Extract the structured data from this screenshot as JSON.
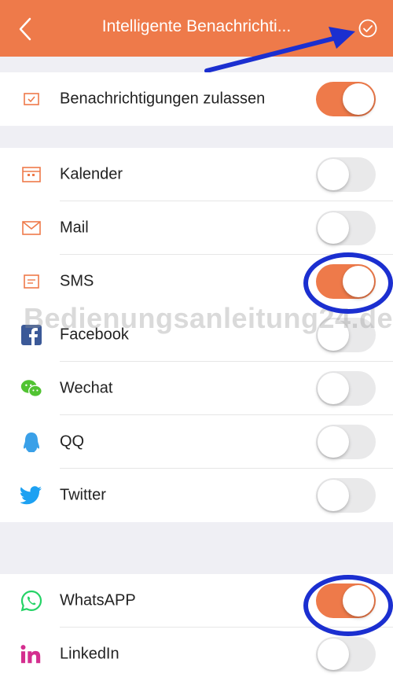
{
  "header": {
    "title": "Intelligente Benachrichti...",
    "back_icon": "chevron-left-icon",
    "confirm_icon": "check-circle-icon"
  },
  "master": {
    "label": "Benachrichtigungen zulassen",
    "enabled": true
  },
  "apps_group1": [
    {
      "label": "Kalender",
      "icon": "calendar-icon",
      "enabled": false
    },
    {
      "label": "Mail",
      "icon": "mail-icon",
      "enabled": false
    },
    {
      "label": "SMS",
      "icon": "message-icon",
      "enabled": true
    },
    {
      "label": "Facebook",
      "icon": "facebook-icon",
      "enabled": false
    },
    {
      "label": "Wechat",
      "icon": "wechat-icon",
      "enabled": false
    },
    {
      "label": "QQ",
      "icon": "qq-icon",
      "enabled": false
    },
    {
      "label": "Twitter",
      "icon": "twitter-icon",
      "enabled": false
    }
  ],
  "apps_group2": [
    {
      "label": "WhatsAPP",
      "icon": "whatsapp-icon",
      "enabled": true
    },
    {
      "label": "LinkedIn",
      "icon": "linkedin-icon",
      "enabled": false
    }
  ],
  "watermark": "Bedienungsanleitung24.de",
  "colors": {
    "accent": "#ee7a4a",
    "annotation": "#1b2fd0"
  }
}
